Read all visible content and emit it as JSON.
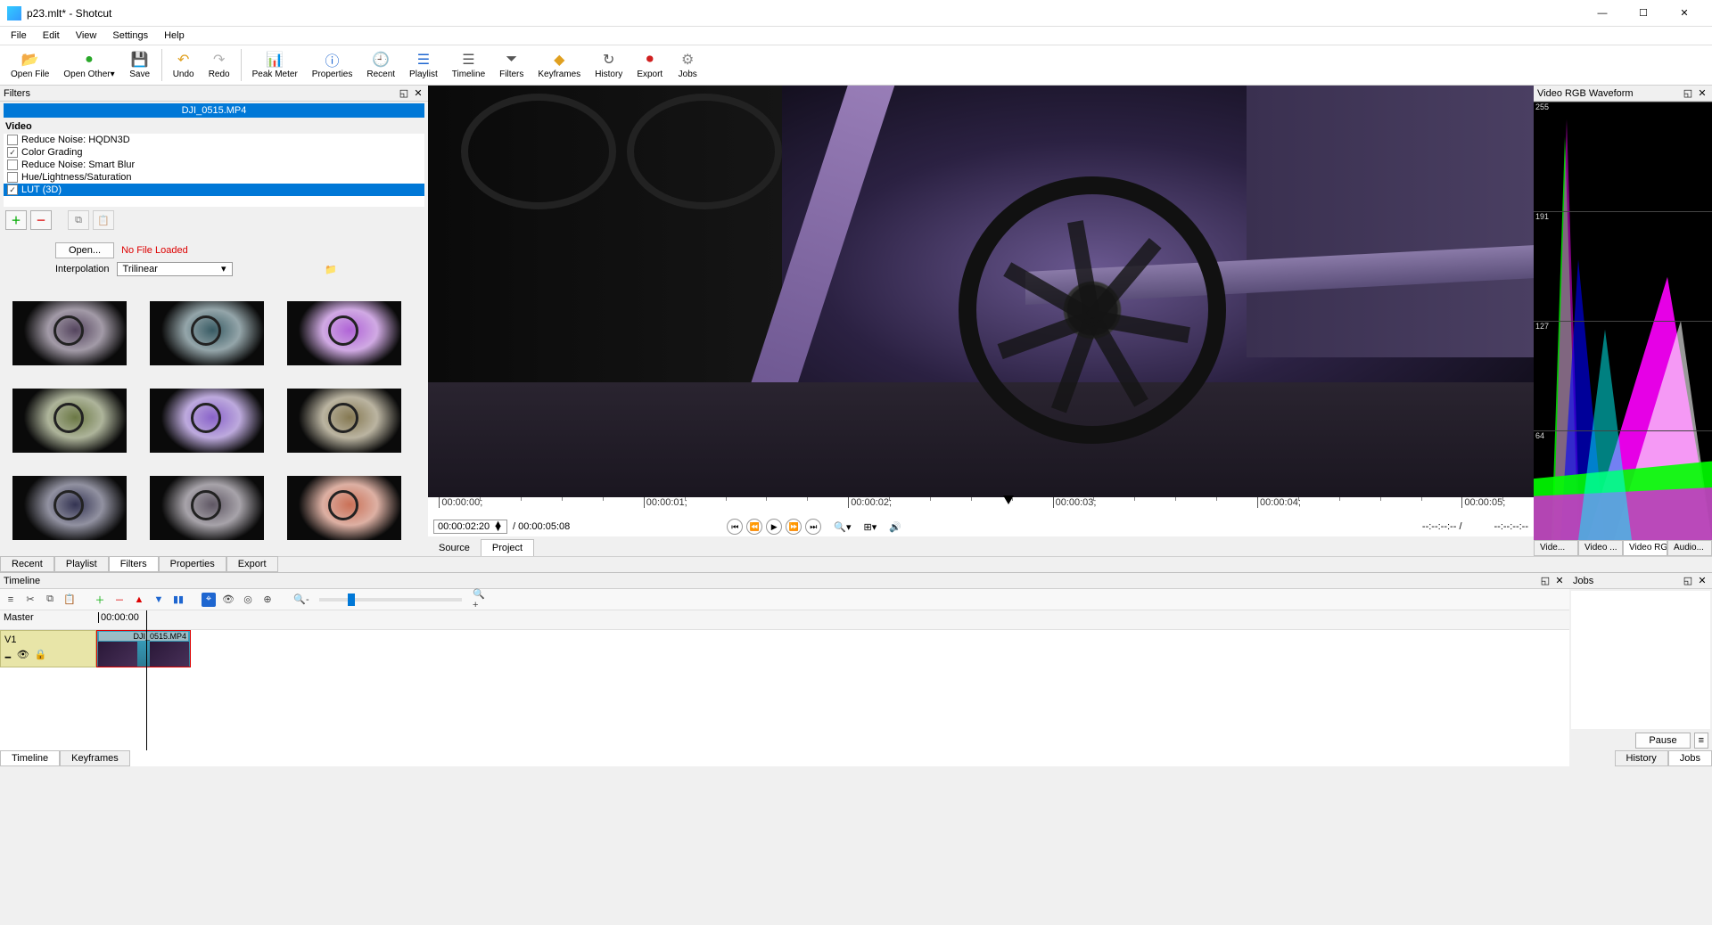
{
  "window": {
    "title": "p23.mlt* - Shotcut"
  },
  "menubar": [
    "File",
    "Edit",
    "View",
    "Settings",
    "Help"
  ],
  "toolbar": [
    {
      "label": "Open File",
      "icon": "📂",
      "color": "#1e66d0"
    },
    {
      "label": "Open Other",
      "icon": "●",
      "color": "#2aa82a",
      "suffix": "▾"
    },
    {
      "label": "Save",
      "icon": "💾",
      "color": "#555"
    },
    {
      "sep": true
    },
    {
      "label": "Undo",
      "icon": "↶",
      "color": "#e0a020"
    },
    {
      "label": "Redo",
      "icon": "↷",
      "color": "#b0b0b0"
    },
    {
      "sep": true
    },
    {
      "label": "Peak Meter",
      "icon": "📊",
      "color": "#555"
    },
    {
      "label": "Properties",
      "icon": "ⓘ",
      "color": "#1e66d0"
    },
    {
      "label": "Recent",
      "icon": "🕘",
      "color": "#1e66d0"
    },
    {
      "label": "Playlist",
      "icon": "☰",
      "color": "#1e66d0"
    },
    {
      "label": "Timeline",
      "icon": "☰",
      "color": "#555"
    },
    {
      "label": "Filters",
      "icon": "⏷",
      "color": "#555"
    },
    {
      "label": "Keyframes",
      "icon": "◆",
      "color": "#e0a020"
    },
    {
      "label": "History",
      "icon": "↻",
      "color": "#555"
    },
    {
      "label": "Export",
      "icon": "⏺",
      "color": "#d02020"
    },
    {
      "label": "Jobs",
      "icon": "⚙",
      "color": "#888"
    }
  ],
  "filters_panel": {
    "title": "Filters",
    "clip_title": "DJI_0515.MP4",
    "group": "Video",
    "filters": [
      {
        "label": "Reduce Noise: HQDN3D",
        "checked": false,
        "selected": false
      },
      {
        "label": "Color Grading",
        "checked": true,
        "selected": false
      },
      {
        "label": "Reduce Noise: Smart Blur",
        "checked": false,
        "selected": false
      },
      {
        "label": "Hue/Lightness/Saturation",
        "checked": false,
        "selected": false
      },
      {
        "label": "LUT (3D)",
        "checked": true,
        "selected": true
      }
    ],
    "open_btn": "Open...",
    "no_file": "No File Loaded",
    "interp_label": "Interpolation",
    "interp_value": "Trilinear",
    "thumb_tints": [
      "#2e1a3a",
      "#0a3540",
      "#a040d0",
      "#4a5a1a",
      "#7040c0",
      "#6a5a2a",
      "#04042a",
      "#3a3040",
      "#c05030"
    ]
  },
  "preview": {
    "ruler_ticks": [
      {
        "label": "00:00:00;",
        "pos": 1
      },
      {
        "label": "00:00:01;",
        "pos": 19.5
      },
      {
        "label": "00:00:02;",
        "pos": 38
      },
      {
        "label": "00:00:03;",
        "pos": 56.5
      },
      {
        "label": "00:00:04;",
        "pos": 75
      },
      {
        "label": "00:00:05;",
        "pos": 93.5
      }
    ],
    "playhead_pos": 52.5,
    "timecode": "00:00:02:20",
    "duration": "00:00:05:08",
    "tc_in": "--:--:--:--",
    "tc_out": "--:--:--:--",
    "source_tab": "Source",
    "project_tab": "Project"
  },
  "waveform": {
    "title": "Video RGB Waveform",
    "grid": [
      {
        "v": "255",
        "pos": 0
      },
      {
        "v": "191",
        "pos": 25
      },
      {
        "v": "127",
        "pos": 50
      },
      {
        "v": "64",
        "pos": 75
      }
    ],
    "tabs": [
      "Vide...",
      "Video ...",
      "Video RG...",
      "Audio..."
    ],
    "active_tab": 2
  },
  "panel_tabs": {
    "left": [
      "Recent",
      "Playlist",
      "Filters",
      "Properties",
      "Export"
    ],
    "left_active": 2
  },
  "timeline": {
    "title": "Timeline",
    "master": "Master",
    "track": "V1",
    "ruler_start": "00:00:00",
    "clip_label": "DJI_0515.MP4",
    "bottom_tabs": [
      "Timeline",
      "Keyframes"
    ],
    "active_tab": 0
  },
  "jobs": {
    "title": "Jobs",
    "pause": "Pause",
    "tabs": [
      "History",
      "Jobs"
    ],
    "active_tab": 1
  }
}
